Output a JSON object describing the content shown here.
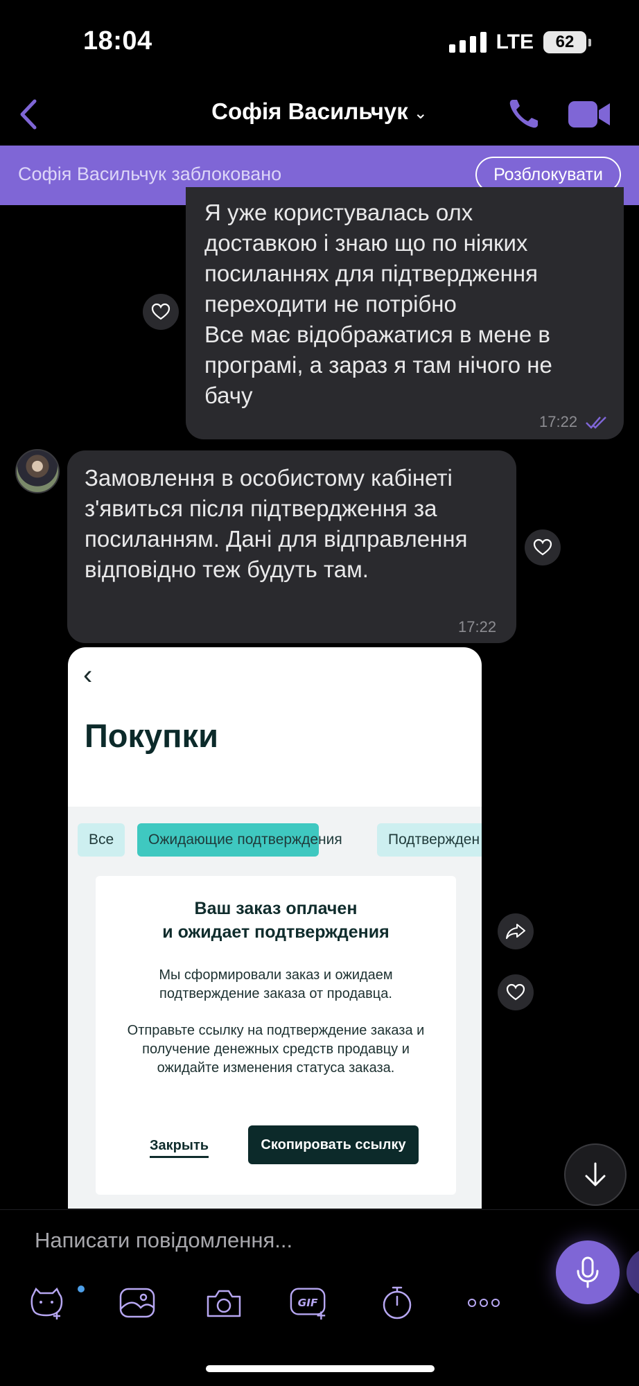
{
  "status_bar": {
    "time": "18:04",
    "network": "LTE",
    "battery": "62"
  },
  "header": {
    "contact_name": "Софія Васильчук",
    "chevron": "⌄"
  },
  "banner": {
    "text": "Софія Васильчук заблоковано",
    "unblock_label": "Розблокувати"
  },
  "messages": {
    "outgoing": {
      "text": "Я уже користувалась олх\nдоставкою і знаю що по ніяких\nпосиланнях для підтвердження\nпереходити не потрібно\nВсе має відображатися в мене в\nпрограмі, а зараз я там нічого не\nбачу",
      "time": "17:22"
    },
    "incoming": {
      "text": "Замовлення в особистому кабінеті з'явиться після підтвердження за посиланням. Дані для відправлення відповідно теж будуть там.",
      "time": "17:22"
    }
  },
  "shared_image": {
    "back": "‹",
    "title": "Покупки",
    "tabs": [
      "Все",
      "Ожидающие подтверждения",
      "Подтвержден"
    ],
    "card_title_1": "Ваш заказ оплачен",
    "card_title_2": "и ожидает подтверждения",
    "card_p1": "Мы сформировали заказ и ожидаем подтверждение заказа от продавца.",
    "card_p2": "Отправьте ссылку на подтверждение заказа и получение денежных средств продавцу и ожидайте изменения статуса заказа.",
    "close_label": "Закрыть",
    "copy_label": "Скопировать ссылку"
  },
  "composer": {
    "placeholder": "Написати повідомлення..."
  },
  "colors": {
    "accent": "#7f66d6",
    "bubble": "#2a2a2e",
    "teal": "#3fc8c0"
  }
}
